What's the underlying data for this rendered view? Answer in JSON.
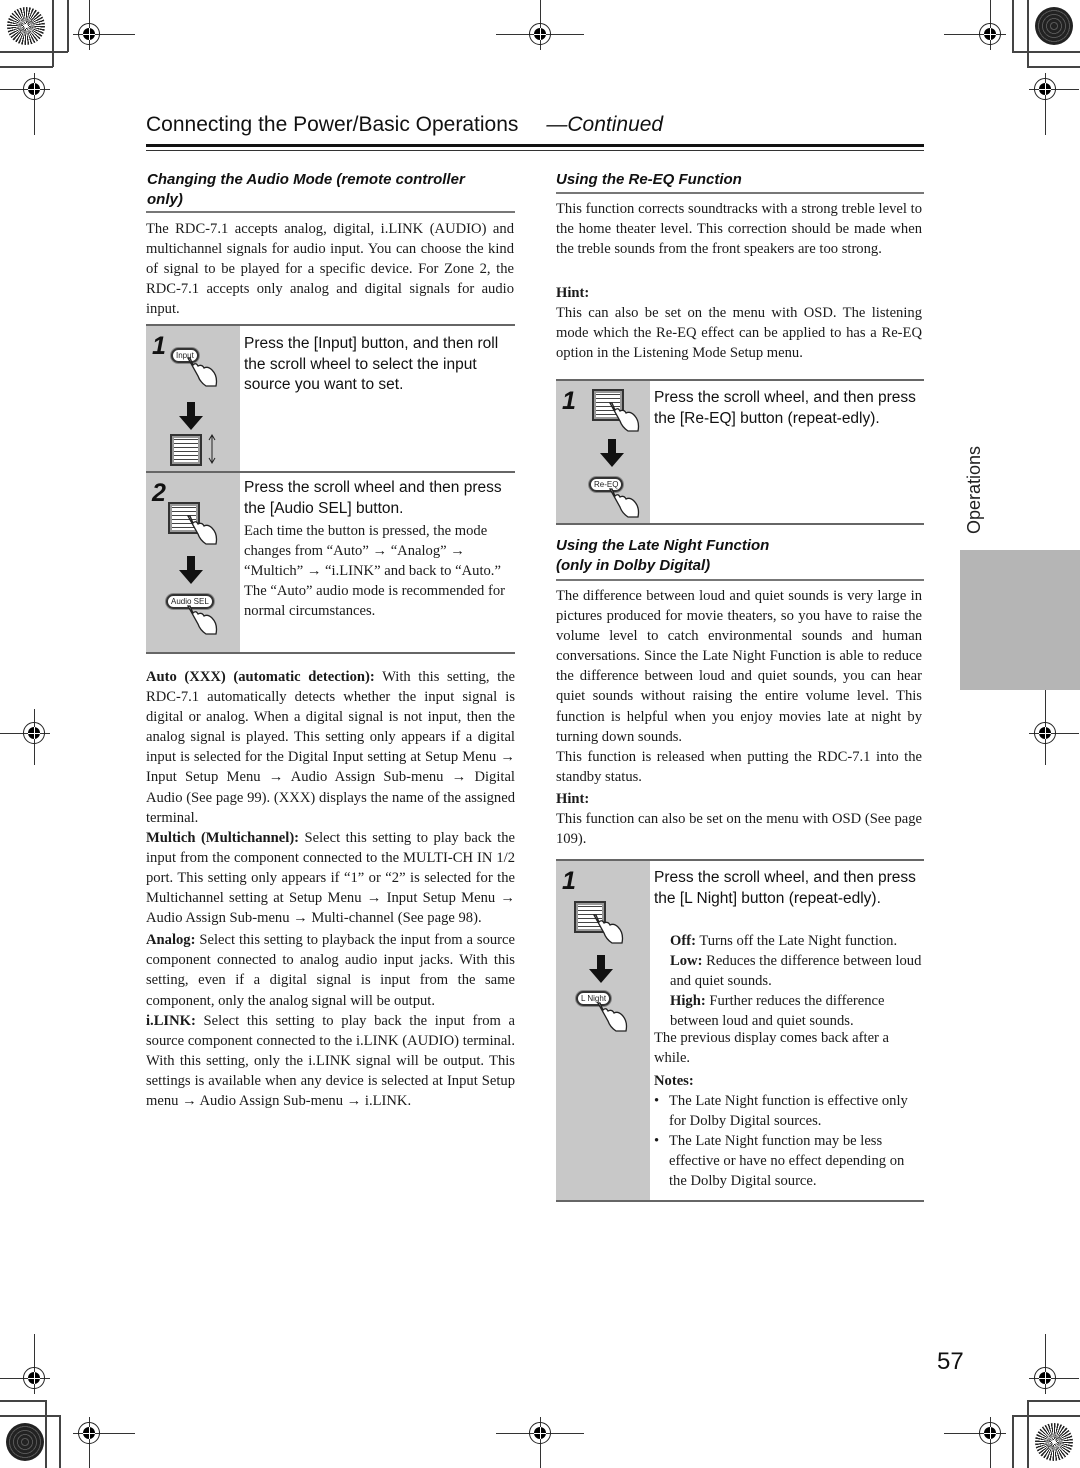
{
  "header": {
    "title": "Connecting the Power/Basic Operations",
    "continued": "—Continued"
  },
  "side_tab": {
    "label": "Operations"
  },
  "page_number": "57",
  "audio_mode": {
    "heading_line1": "Changing the Audio Mode (remote controller",
    "heading_line2": "only)",
    "intro": "The RDC-7.1 accepts analog, digital, i.LINK (AUDIO) and multichannel signals for audio input. You can choose the kind of signal to be played for a specific device. For Zone 2, the RDC-7.1 accepts only analog and digital signals for audio input.",
    "steps": [
      {
        "number": "1",
        "instruction": "Press the [Input] button, and then roll the scroll wheel to select the input source you want to set.",
        "button_label": "Input"
      },
      {
        "number": "2",
        "instruction": "Press the scroll wheel and then press the [Audio SEL] button.",
        "detail": "Each time the button is pressed, the mode changes from “Auto” → “Analog” → “Multich” → “i.LINK” and back to “Auto.” The “Auto” audio mode is recommended for normal circumstances.",
        "button_label": "Audio SEL"
      }
    ],
    "options": [
      {
        "term": "Auto (XXX) (automatic detection):",
        "text": " With this setting, the RDC-7.1 automatically detects whether the input signal is digital or analog. When a digital signal is not input, then the analog signal is played. This setting only appears if a digital input is selected for the Digital Input setting at Setup Menu → Input Setup Menu → Audio Assign Sub-menu → Digital Audio (See page 99). (XXX) displays the name of the assigned terminal."
      },
      {
        "term": "Multich (Multichannel):",
        "text": " Select this setting to play back the input from the component connected to the MULTI-CH IN 1/2 port. This setting only appears if “1” or “2” is selected for the Multichannel setting at Setup Menu → Input Setup Menu → Audio Assign Sub-menu → Multi-channel (See page 98)."
      },
      {
        "term": "Analog:",
        "text": " Select this setting to playback the input from a source component connected to analog audio input jacks. With this setting, even if a digital signal is input from the same component, only the analog signal will be output."
      },
      {
        "term": "i.LINK:",
        "text": " Select this setting to play back the input from a source component connected to the i.LINK (AUDIO) terminal. With this setting, only the i.LINK signal will be output. This settings is available when any device is selected at Input Setup menu → Audio Assign Sub-menu → i.LINK."
      }
    ]
  },
  "re_eq": {
    "heading": "Using the Re-EQ Function",
    "intro": "This function corrects soundtracks with a strong treble level to the home theater level. This correction should be made when the treble sounds from the front speakers are too strong.",
    "hint_label": "Hint:",
    "hint": "This can also be set on the menu with OSD. The listening mode which the Re-EQ effect can be applied to has a Re-EQ option in the Listening Mode Setup menu.",
    "step": {
      "number": "1",
      "instruction": "Press the scroll wheel, and then press the [Re-EQ] button (repeat-edly).",
      "button_label": "Re-EQ"
    }
  },
  "late_night": {
    "heading_line1": "Using the Late Night Function",
    "heading_line2": "(only in Dolby Digital)",
    "intro": "The difference between loud and quiet sounds is very large in pictures produced for movie theaters, so you have to raise the volume level to catch environmental sounds and human conversations. Since the Late Night Function is able to reduce the difference between loud and quiet sounds, you can hear quiet sounds without raising the entire volume level. This function is helpful when you enjoy movies late at night by turning down sounds.",
    "release": "This function is released when putting the RDC-7.1 into the standby status.",
    "hint_label": "Hint:",
    "hint": "This function can also be set on the menu with OSD (See page 109).",
    "step": {
      "number": "1",
      "instruction": "Press the scroll wheel, and then press the [L Night] button (repeat-edly).",
      "button_label": "L Night",
      "modes": [
        {
          "term": "Off:",
          "text": " Turns off the Late Night function."
        },
        {
          "term": "Low:",
          "text": " Reduces the difference between loud and quiet sounds."
        },
        {
          "term": "High:",
          "text": " Further reduces the difference between loud and quiet sounds."
        }
      ],
      "after": "The previous display comes back after a while.",
      "notes_label": "Notes:",
      "notes": [
        "The Late Night function is effective only for Dolby Digital sources.",
        "The Late Night function may be less effective or have no effect depending on the Dolby Digital source."
      ]
    }
  }
}
